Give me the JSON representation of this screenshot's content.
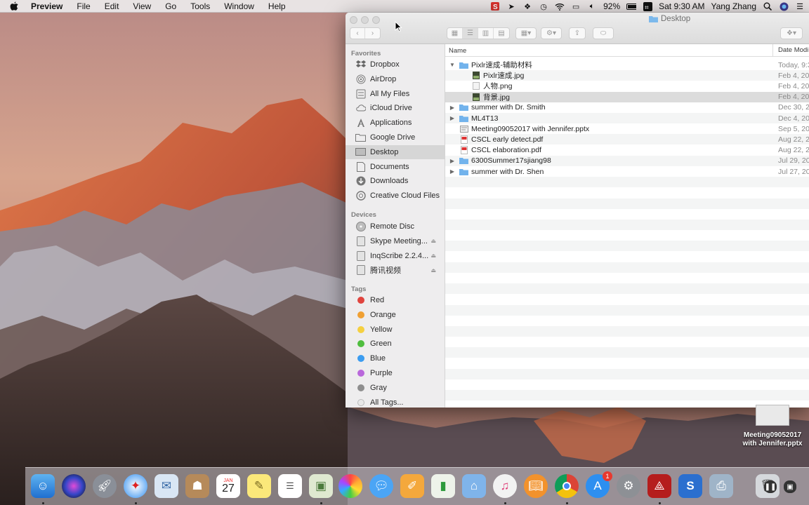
{
  "menubar": {
    "app": "Preview",
    "items": [
      "File",
      "Edit",
      "View",
      "Go",
      "Tools",
      "Window",
      "Help"
    ],
    "battery": "92%",
    "clock": "Sat 9:30 AM",
    "user": "Yang Zhang"
  },
  "finder": {
    "title": "Desktop",
    "sidebar": {
      "favorites_heading": "Favorites",
      "favorites": [
        {
          "label": "Dropbox",
          "icon": "dropbox-icon"
        },
        {
          "label": "AirDrop",
          "icon": "airdrop-icon"
        },
        {
          "label": "All My Files",
          "icon": "all-files-icon"
        },
        {
          "label": "iCloud Drive",
          "icon": "cloud-icon"
        },
        {
          "label": "Applications",
          "icon": "applications-icon"
        },
        {
          "label": "Google Drive",
          "icon": "folder-icon"
        },
        {
          "label": "Desktop",
          "icon": "desktop-icon"
        },
        {
          "label": "Documents",
          "icon": "documents-icon"
        },
        {
          "label": "Downloads",
          "icon": "downloads-icon"
        },
        {
          "label": "Creative Cloud Files",
          "icon": "creative-cloud-icon"
        }
      ],
      "devices_heading": "Devices",
      "devices": [
        {
          "label": "Remote Disc",
          "icon": "disc-icon"
        },
        {
          "label": "Skype Meeting...",
          "icon": "drive-icon"
        },
        {
          "label": "InqScribe 2.2.4...",
          "icon": "drive-icon"
        },
        {
          "label": "腾讯视频",
          "icon": "drive-icon"
        }
      ],
      "tags_heading": "Tags",
      "tags": [
        {
          "label": "Red",
          "color": "#e0443e"
        },
        {
          "label": "Orange",
          "color": "#f0a033"
        },
        {
          "label": "Yellow",
          "color": "#f5d040"
        },
        {
          "label": "Green",
          "color": "#4fbd3e"
        },
        {
          "label": "Blue",
          "color": "#3b9cf0"
        },
        {
          "label": "Purple",
          "color": "#b968db"
        },
        {
          "label": "Gray",
          "color": "#8e8e8e"
        },
        {
          "label": "All Tags...",
          "color": "#e8e8e8"
        }
      ]
    },
    "columns": {
      "name": "Name",
      "date": "Date Modi"
    },
    "files": [
      {
        "name": "Pixlr速成-辅助材料",
        "date": "Today, 9:3",
        "type": "folder",
        "level": 0,
        "expanded": true
      },
      {
        "name": "Pixlr速成.jpg",
        "date": "Feb 4, 20",
        "type": "image",
        "level": 1
      },
      {
        "name": "人物.png",
        "date": "Feb 4, 20",
        "type": "png",
        "level": 1
      },
      {
        "name": "背景.jpg",
        "date": "Feb 4, 20",
        "type": "image",
        "level": 1
      },
      {
        "name": "summer with Dr. Smith",
        "date": "Dec 30, 2",
        "type": "folder",
        "level": 0
      },
      {
        "name": "ML4T13",
        "date": "Dec 4, 20",
        "type": "folder",
        "level": 0
      },
      {
        "name": "Meeting09052017 with Jennifer.pptx",
        "date": "Sep 5, 20",
        "type": "pptx",
        "level": 0
      },
      {
        "name": "CSCL early detect.pdf",
        "date": "Aug 22, 2",
        "type": "pdf",
        "level": 0
      },
      {
        "name": "CSCL elaboration.pdf",
        "date": "Aug 22, 2",
        "type": "pdf",
        "level": 0
      },
      {
        "name": "6300Summer17sjiang98",
        "date": "Jul 29, 20",
        "type": "folder",
        "level": 0
      },
      {
        "name": "summer with Dr. Shen",
        "date": "Jul 27, 20",
        "type": "folder",
        "level": 0
      }
    ]
  },
  "desktop_file": {
    "label_line1": "Meeting09052017",
    "label_line2": "with Jennifer.pptx"
  },
  "dock": {
    "calendar_month": "JAN",
    "calendar_day": "27",
    "app_store_badge": "1",
    "apps": [
      "Finder",
      "Siri",
      "Launchpad",
      "Safari",
      "Mail",
      "Contacts",
      "Calendar",
      "Notes",
      "Reminders",
      "Preview",
      "Photos",
      "Messages",
      "Pages",
      "Numbers",
      "Keynote",
      "iTunes",
      "iBooks",
      "Chrome",
      "App Store",
      "System Preferences",
      "Acrobat",
      "Snagit",
      "Image Capture",
      "Trash"
    ]
  }
}
